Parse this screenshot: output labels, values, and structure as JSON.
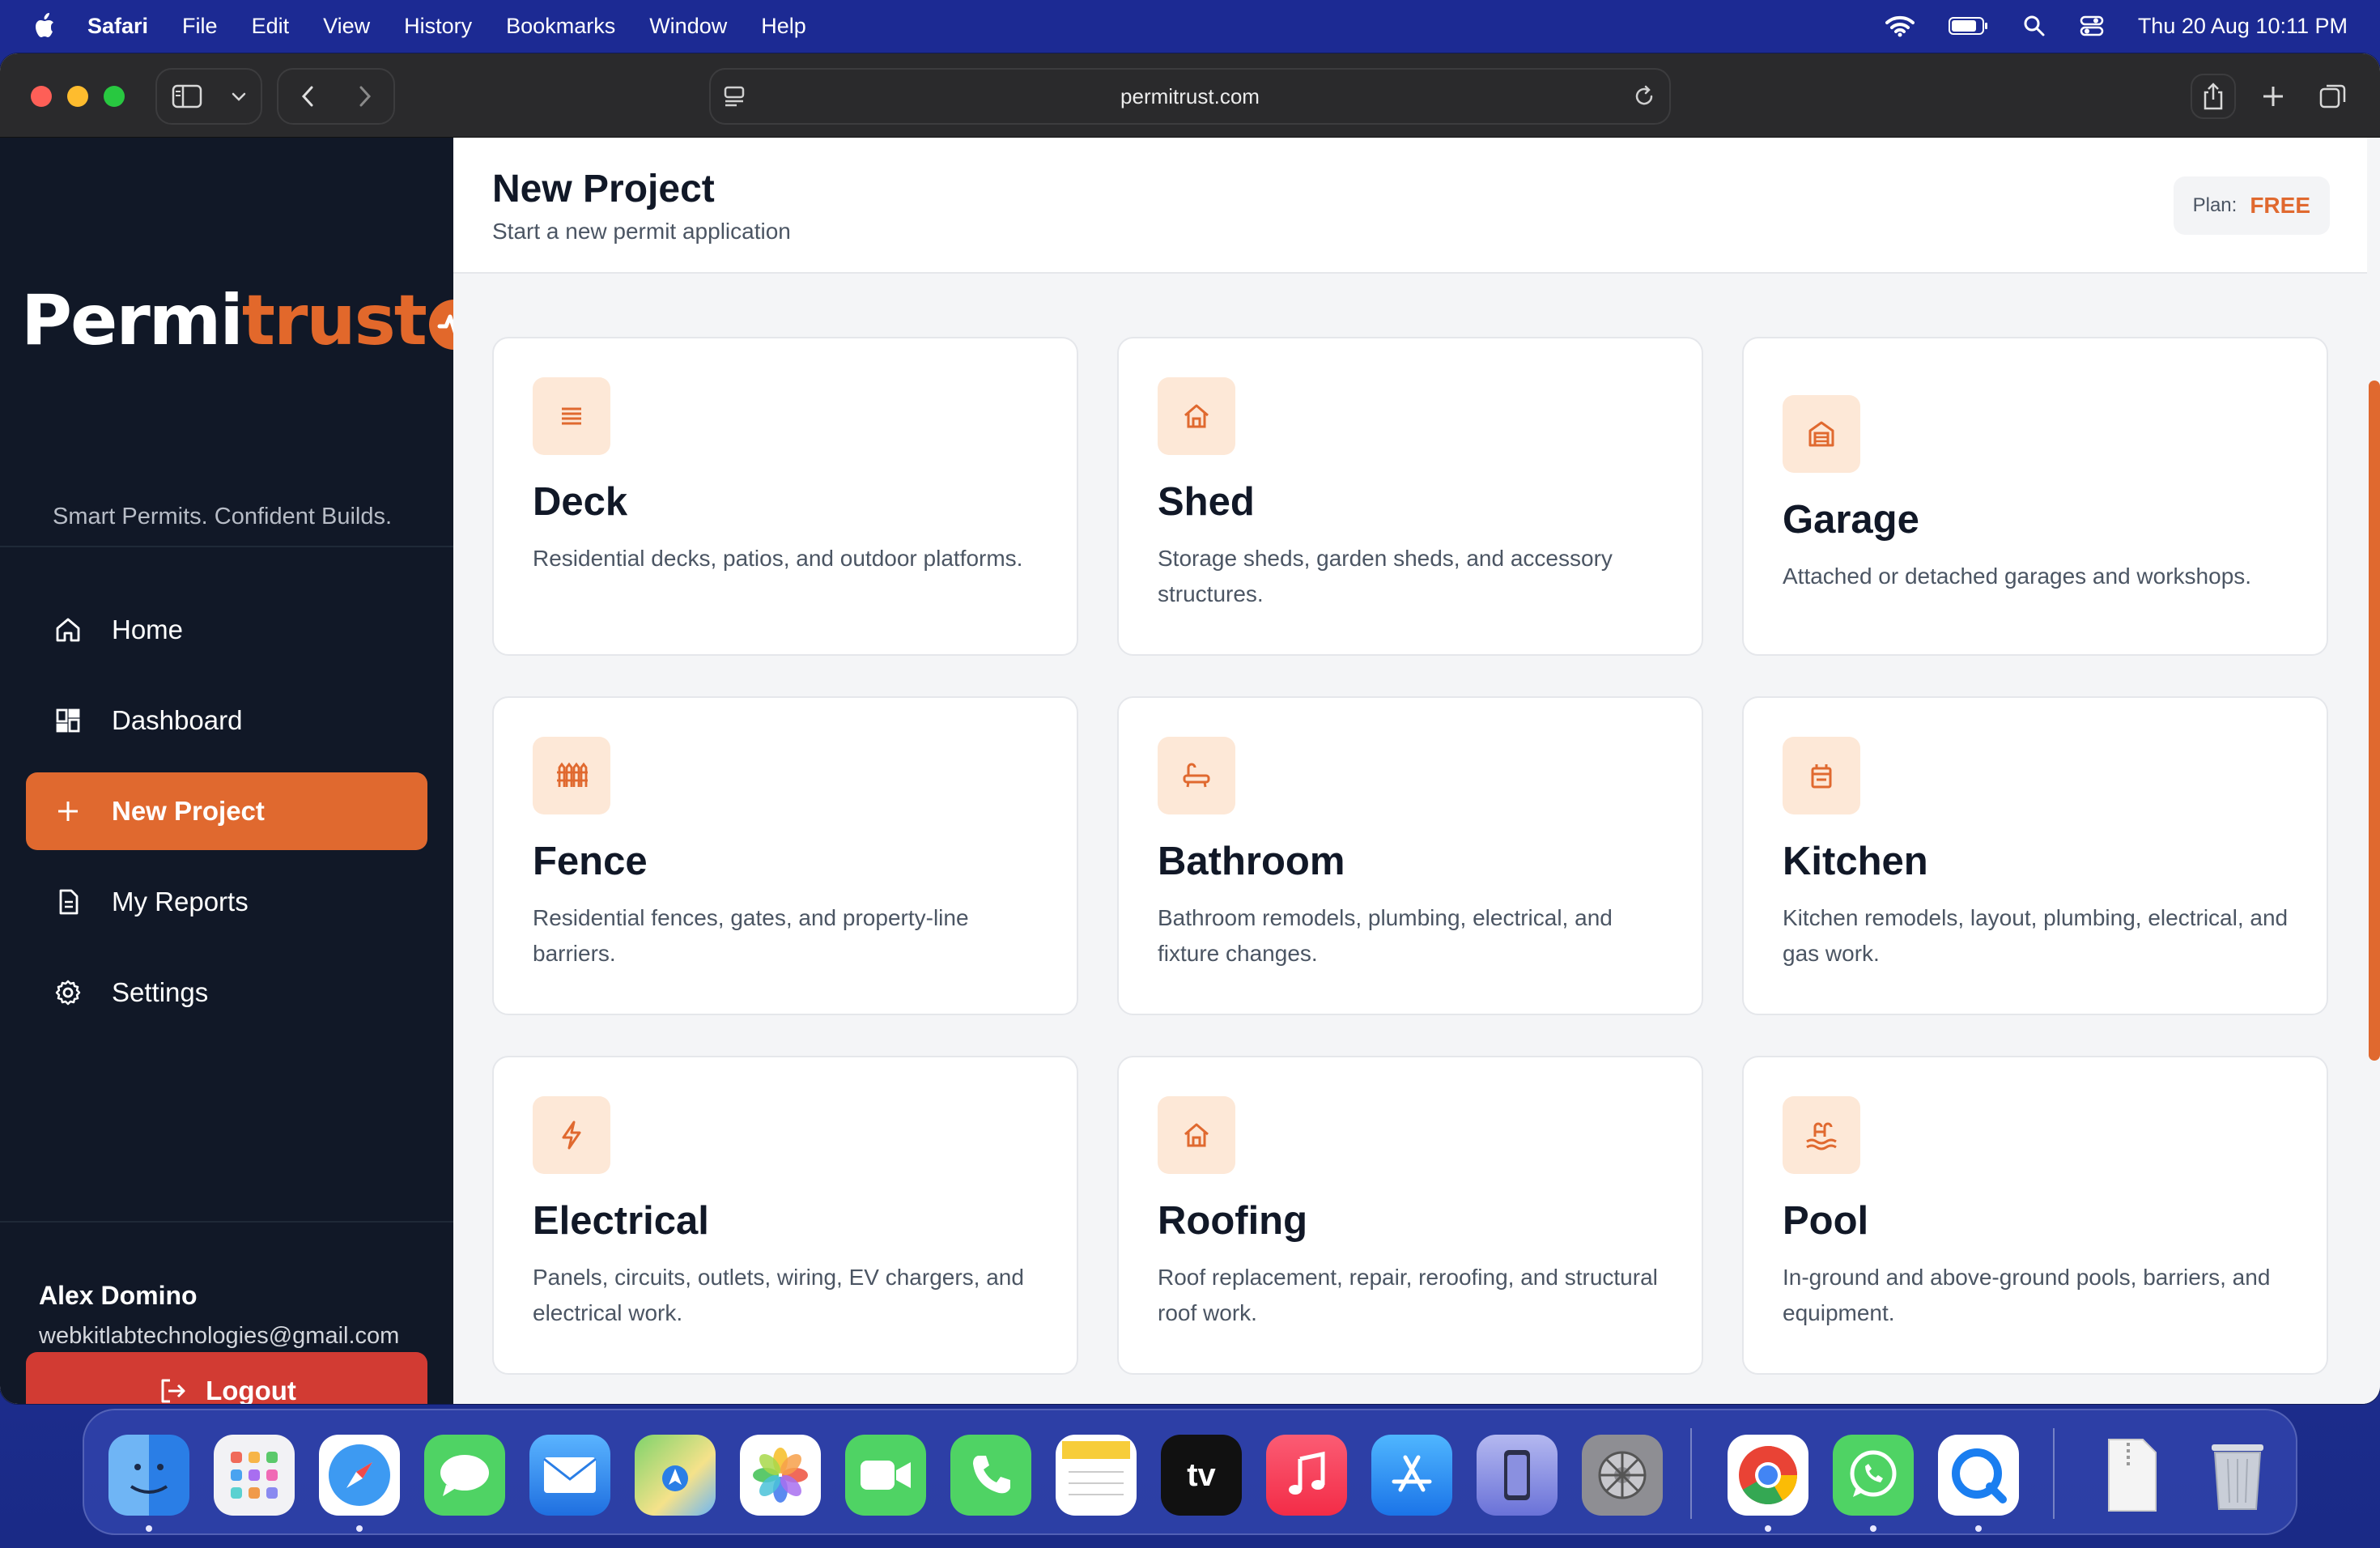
{
  "menubar": {
    "app_name": "Safari",
    "menus": [
      "File",
      "Edit",
      "View",
      "History",
      "Bookmarks",
      "Window",
      "Help"
    ],
    "clock": "Thu 20 Aug  10:11 PM"
  },
  "browser": {
    "url": "permitrust.com"
  },
  "sidebar": {
    "logo_white": "Permi",
    "logo_orange": "trust",
    "tagline": "Smart Permits. Confident Builds.",
    "items": [
      {
        "label": "Home",
        "icon": "home-icon"
      },
      {
        "label": "Dashboard",
        "icon": "dashboard-icon"
      },
      {
        "label": "New Project",
        "icon": "plus-icon",
        "active": true
      },
      {
        "label": "My Reports",
        "icon": "document-icon"
      },
      {
        "label": "Settings",
        "icon": "gear-icon"
      }
    ],
    "user": {
      "name": "Alex Domino",
      "email": "webkitlabtechnologies@gmail.com"
    },
    "logout_label": "Logout"
  },
  "header": {
    "title": "New Project",
    "subtitle": "Start a new permit application",
    "plan_label": "Plan:",
    "plan_value": "FREE"
  },
  "project_types": [
    {
      "title": "Deck",
      "description": "Residential decks, patios, and outdoor platforms.",
      "icon": "deck-icon"
    },
    {
      "title": "Shed",
      "description": "Storage sheds, garden sheds, and accessory structures.",
      "icon": "house-icon"
    },
    {
      "title": "Garage",
      "description": "Attached or detached garages and workshops.",
      "icon": "garage-icon"
    },
    {
      "title": "Fence",
      "description": "Residential fences, gates, and property-line barriers.",
      "icon": "fence-icon"
    },
    {
      "title": "Bathroom",
      "description": "Bathroom remodels, plumbing, electrical, and fixture changes.",
      "icon": "bath-icon"
    },
    {
      "title": "Kitchen",
      "description": "Kitchen remodels, layout, plumbing, electrical, and gas work.",
      "icon": "kitchen-icon"
    },
    {
      "title": "Electrical",
      "description": "Panels, circuits, outlets, wiring, EV chargers, and electrical work.",
      "icon": "lightning-icon"
    },
    {
      "title": "Roofing",
      "description": "Roof replacement, repair, reroofing, and structural roof work.",
      "icon": "house-icon"
    },
    {
      "title": "Pool",
      "description": "In-ground and above-ground pools, barriers, and equipment.",
      "icon": "pool-icon"
    }
  ],
  "colors": {
    "accent": "#e0692f",
    "sidebar_bg": "#111827",
    "logout": "#d23b33",
    "icon_bg": "#fde8d7"
  },
  "dock": {
    "apps": [
      "finder-icon",
      "launchpad-icon",
      "safari-icon",
      "messages-icon",
      "mail-icon",
      "maps-icon",
      "photos-icon",
      "facetime-icon",
      "phone-icon",
      "notes-icon",
      "apple-tv-icon",
      "music-icon",
      "app-store-icon",
      "iphone-mirroring-icon",
      "system-settings-icon",
      "chrome-icon",
      "whatsapp-icon",
      "quicktime-icon",
      "archive-icon",
      "trash-icon"
    ],
    "tv_label": "tv"
  }
}
